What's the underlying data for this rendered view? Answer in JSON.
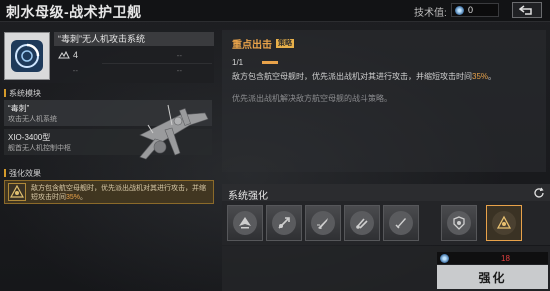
{
  "header": {
    "title": "刺水母级-战术护卫舰",
    "tech_label": "技术值:",
    "tech_value": "0"
  },
  "weapon": {
    "name": "“毒刺”无人机攻击系统",
    "level": "4",
    "slots": [
      "--",
      "--",
      "--",
      "--"
    ]
  },
  "modules": {
    "section_label": "系统模块",
    "items": [
      {
        "name": "“毒刺”",
        "desc": "攻击无人机系统"
      },
      {
        "name": "XIO-3400型",
        "desc": "舰首无人机控制中枢"
      }
    ]
  },
  "effect": {
    "section_label": "强化效果",
    "text_before": "敌方包含航空母舰时，优先派出战机对其进行攻击，并缩短攻击时间",
    "pct": "35%",
    "text_after": "。"
  },
  "info": {
    "title": "重点出击",
    "tag": "策略",
    "page": "1/1",
    "desc_before": "敌方包含航空母舰时，优先派出战机对其进行攻击，并缩短攻击时间",
    "desc_pct": "35%",
    "desc_after": "。",
    "desc2": "优先派出战机解决敌方航空母舰的战斗策略。"
  },
  "enhance": {
    "title": "系统强化",
    "slots": [
      {
        "icon": "drone-icon"
      },
      {
        "icon": "attack-icon"
      },
      {
        "icon": "missile-icon"
      },
      {
        "icon": "strike-icon"
      },
      {
        "icon": "blade-icon"
      },
      {
        "icon": "shield-drone-icon"
      },
      {
        "icon": "focus-strike-icon"
      }
    ],
    "selected_index": 6,
    "cost_have": "18",
    "button_label": "强化"
  },
  "colors": {
    "accent": "#e8a24a",
    "warning": "#e04040"
  }
}
